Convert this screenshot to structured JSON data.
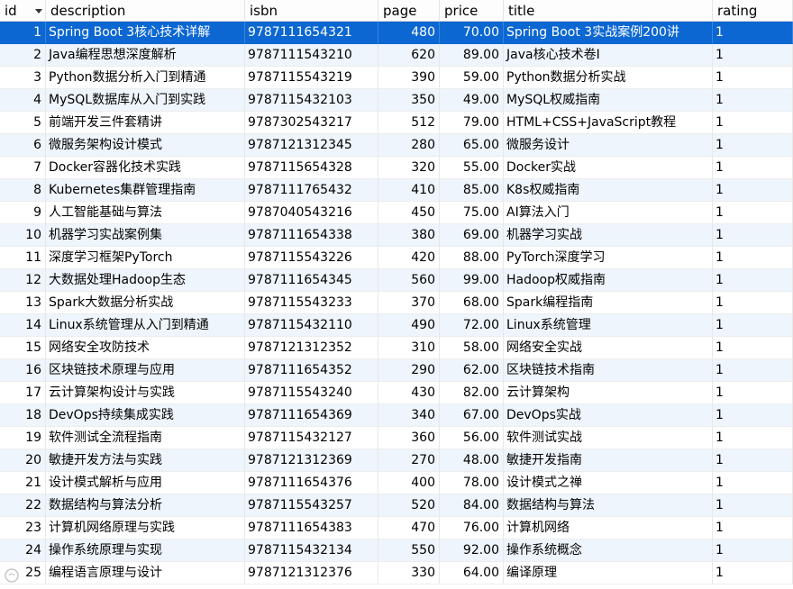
{
  "columns": [
    {
      "key": "id",
      "label": "id"
    },
    {
      "key": "description",
      "label": "description"
    },
    {
      "key": "isbn",
      "label": "isbn"
    },
    {
      "key": "page",
      "label": "page"
    },
    {
      "key": "price",
      "label": "price"
    },
    {
      "key": "title",
      "label": "title"
    },
    {
      "key": "rating",
      "label": "rating"
    }
  ],
  "sort": {
    "column": "id",
    "direction": "desc-indicator"
  },
  "selected_row": 0,
  "colors": {
    "selection": "#0c67d2",
    "alt_row": "#eef5fc"
  },
  "rows": [
    {
      "id": "1",
      "description": "Spring Boot 3核心技术详解",
      "isbn": "9787111654321",
      "page": "480",
      "price": "70.00",
      "title": "Spring Boot 3实战案例200讲",
      "rating": "1"
    },
    {
      "id": "2",
      "description": "Java编程思想深度解析",
      "isbn": "9787111543210",
      "page": "620",
      "price": "89.00",
      "title": "Java核心技术卷I",
      "rating": "1"
    },
    {
      "id": "3",
      "description": "Python数据分析入门到精通",
      "isbn": "9787115543219",
      "page": "390",
      "price": "59.00",
      "title": "Python数据分析实战",
      "rating": "1"
    },
    {
      "id": "4",
      "description": "MySQL数据库从入门到实践",
      "isbn": "9787115432103",
      "page": "350",
      "price": "49.00",
      "title": "MySQL权威指南",
      "rating": "1"
    },
    {
      "id": "5",
      "description": "前端开发三件套精讲",
      "isbn": "9787302543217",
      "page": "512",
      "price": "79.00",
      "title": "HTML+CSS+JavaScript教程",
      "rating": "1"
    },
    {
      "id": "6",
      "description": "微服务架构设计模式",
      "isbn": "9787121312345",
      "page": "280",
      "price": "65.00",
      "title": "微服务设计",
      "rating": "1"
    },
    {
      "id": "7",
      "description": "Docker容器化技术实践",
      "isbn": "9787115654328",
      "page": "320",
      "price": "55.00",
      "title": "Docker实战",
      "rating": "1"
    },
    {
      "id": "8",
      "description": "Kubernetes集群管理指南",
      "isbn": "9787111765432",
      "page": "410",
      "price": "85.00",
      "title": "K8s权威指南",
      "rating": "1"
    },
    {
      "id": "9",
      "description": "人工智能基础与算法",
      "isbn": "9787040543216",
      "page": "450",
      "price": "75.00",
      "title": "AI算法入门",
      "rating": "1"
    },
    {
      "id": "10",
      "description": "机器学习实战案例集",
      "isbn": "9787111654338",
      "page": "380",
      "price": "69.00",
      "title": "机器学习实战",
      "rating": "1"
    },
    {
      "id": "11",
      "description": "深度学习框架PyTorch",
      "isbn": "9787115543226",
      "page": "420",
      "price": "88.00",
      "title": "PyTorch深度学习",
      "rating": "1"
    },
    {
      "id": "12",
      "description": "大数据处理Hadoop生态",
      "isbn": "9787111654345",
      "page": "560",
      "price": "99.00",
      "title": "Hadoop权威指南",
      "rating": "1"
    },
    {
      "id": "13",
      "description": "Spark大数据分析实战",
      "isbn": "9787115543233",
      "page": "370",
      "price": "68.00",
      "title": "Spark编程指南",
      "rating": "1"
    },
    {
      "id": "14",
      "description": "Linux系统管理从入门到精通",
      "isbn": "9787115432110",
      "page": "490",
      "price": "72.00",
      "title": "Linux系统管理",
      "rating": "1"
    },
    {
      "id": "15",
      "description": "网络安全攻防技术",
      "isbn": "9787121312352",
      "page": "310",
      "price": "58.00",
      "title": "网络安全实战",
      "rating": "1"
    },
    {
      "id": "16",
      "description": "区块链技术原理与应用",
      "isbn": "9787111654352",
      "page": "290",
      "price": "62.00",
      "title": "区块链技术指南",
      "rating": "1"
    },
    {
      "id": "17",
      "description": "云计算架构设计与实践",
      "isbn": "9787115543240",
      "page": "430",
      "price": "82.00",
      "title": "云计算架构",
      "rating": "1"
    },
    {
      "id": "18",
      "description": "DevOps持续集成实践",
      "isbn": "9787111654369",
      "page": "340",
      "price": "67.00",
      "title": "DevOps实战",
      "rating": "1"
    },
    {
      "id": "19",
      "description": "软件测试全流程指南",
      "isbn": "9787115432127",
      "page": "360",
      "price": "56.00",
      "title": "软件测试实战",
      "rating": "1"
    },
    {
      "id": "20",
      "description": "敏捷开发方法与实践",
      "isbn": "9787121312369",
      "page": "270",
      "price": "48.00",
      "title": "敏捷开发指南",
      "rating": "1"
    },
    {
      "id": "21",
      "description": "设计模式解析与应用",
      "isbn": "9787111654376",
      "page": "400",
      "price": "78.00",
      "title": "设计模式之禅",
      "rating": "1"
    },
    {
      "id": "22",
      "description": "数据结构与算法分析",
      "isbn": "9787115543257",
      "page": "520",
      "price": "84.00",
      "title": "数据结构与算法",
      "rating": "1"
    },
    {
      "id": "23",
      "description": "计算机网络原理与实践",
      "isbn": "9787111654383",
      "page": "470",
      "price": "76.00",
      "title": "计算机网络",
      "rating": "1"
    },
    {
      "id": "24",
      "description": "操作系统原理与实现",
      "isbn": "9787115432134",
      "page": "550",
      "price": "92.00",
      "title": "操作系统概念",
      "rating": "1"
    },
    {
      "id": "25",
      "description": "编程语言原理与设计",
      "isbn": "9787121312376",
      "page": "330",
      "price": "64.00",
      "title": "编译原理",
      "rating": "1"
    }
  ]
}
